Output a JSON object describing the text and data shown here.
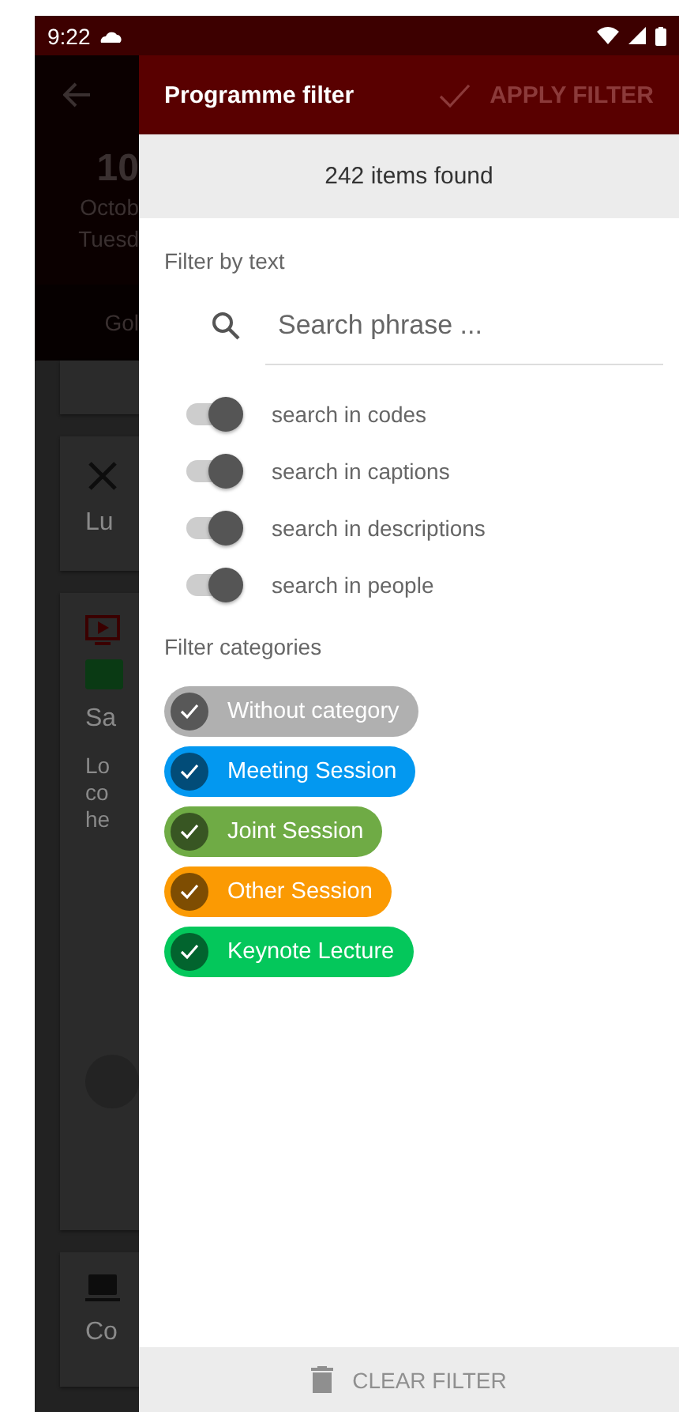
{
  "status_bar": {
    "time": "9:22"
  },
  "background": {
    "date_day": "10",
    "month": "Octob",
    "weekday": "Tuesd",
    "tab": "Gol",
    "cards": [
      {
        "kind": "stub"
      },
      {
        "kind": "meal",
        "title": "Lu"
      },
      {
        "kind": "session",
        "title": "Sa",
        "lines": [
          "Lo",
          "co",
          "he"
        ]
      },
      {
        "kind": "computer",
        "title": "Co"
      }
    ]
  },
  "drawer": {
    "title": "Programme filter",
    "apply_button": {
      "label": "APPLY FILTER",
      "disabled": true
    },
    "result_count": "242 items found",
    "text_section": {
      "label": "Filter by text",
      "search": {
        "placeholder": "Search phrase ..."
      },
      "toggles": [
        {
          "label": "search in codes",
          "on": true
        },
        {
          "label": "search in captions",
          "on": true
        },
        {
          "label": "search in descriptions",
          "on": true
        },
        {
          "label": "search in people",
          "on": true
        }
      ]
    },
    "categories_section": {
      "label": "Filter categories",
      "chips": [
        {
          "label": "Without category",
          "color": "#b0b0b0",
          "checked": true
        },
        {
          "label": "Meeting Session",
          "color": "#0398f0",
          "checked": true
        },
        {
          "label": "Joint Session",
          "color": "#6fab45",
          "checked": true
        },
        {
          "label": "Other Session",
          "color": "#fb9a03",
          "checked": true
        },
        {
          "label": "Keynote Lecture",
          "color": "#04c75b",
          "checked": true
        }
      ]
    },
    "clear_button": {
      "label": "CLEAR FILTER",
      "disabled": true
    }
  }
}
